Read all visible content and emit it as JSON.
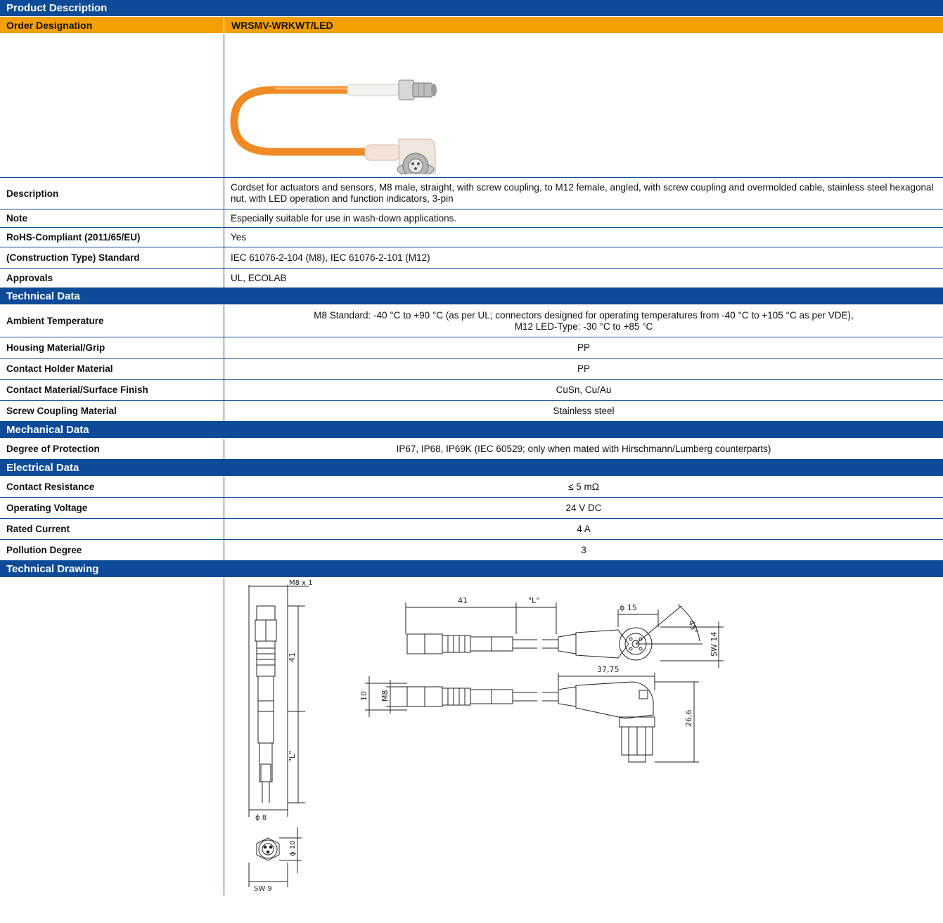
{
  "sections": {
    "product": "Product Description",
    "technical": "Technical Data",
    "mechanical": "Mechanical Data",
    "electrical": "Electrical Data",
    "drawing": "Technical Drawing"
  },
  "order": {
    "label": "Order Designation",
    "value": "WRSMV-WRKWT/LED"
  },
  "product_rows": [
    {
      "label": "Description",
      "value": "Cordset for actuators and sensors, M8 male, straight, with screw coupling, to M12 female, angled, with screw coupling and overmolded cable, stainless steel hexagonal nut, with LED operation and function indicators, 3-pin"
    },
    {
      "label": "Note",
      "value": "Especially suitable for use in wash-down applications."
    },
    {
      "label": "RoHS-Compliant (2011/65/EU)",
      "value": "Yes"
    },
    {
      "label": "(Construction Type) Standard",
      "value": "IEC 61076-2-104 (M8), IEC 61076-2-101 (M12)"
    },
    {
      "label": "Approvals",
      "value": "UL, ECOLAB"
    }
  ],
  "technical_rows": [
    {
      "label": "Ambient Temperature",
      "value_line1": "M8 Standard: -40 °C to +90 °C (as per UL; connectors designed for operating temperatures from -40 °C to +105 °C as per VDE),",
      "value_line2": "M12 LED-Type: -30 °C to +85 °C"
    },
    {
      "label": "Housing Material/Grip",
      "value": "PP"
    },
    {
      "label": "Contact Holder Material",
      "value": "PP"
    },
    {
      "label": "Contact Material/Surface Finish",
      "value": "CuSn, Cu/Au"
    },
    {
      "label": "Screw Coupling Material",
      "value": "Stainless steel"
    }
  ],
  "mechanical_rows": [
    {
      "label": "Degree of Protection",
      "value": "IP67, IP68, IP69K (IEC 60529; only when mated with Hirschmann/Lumberg counterparts)"
    }
  ],
  "electrical_rows": [
    {
      "label": "Contact Resistance",
      "value": "≤ 5 mΩ"
    },
    {
      "label": "Operating Voltage",
      "value": "24 V DC"
    },
    {
      "label": "Rated Current",
      "value": "4 A"
    },
    {
      "label": "Pollution Degree",
      "value": "3"
    }
  ],
  "drawing_dims": {
    "thread": "M8 x 1",
    "len41": "41",
    "lenL": "\"L\"",
    "dia8": "ϕ  8",
    "dia10": "ϕ  10",
    "sw9": "SW  9",
    "dia15": "ϕ  15",
    "angle45": "45°",
    "sw14": "SW 14",
    "h10": "10",
    "m8": "M8",
    "len3775": "37,75",
    "h266": "26,6"
  },
  "colors": {
    "section_blue": "#0d4b98",
    "header_orange": "#f5a000",
    "cable_orange": "#f08a24"
  }
}
